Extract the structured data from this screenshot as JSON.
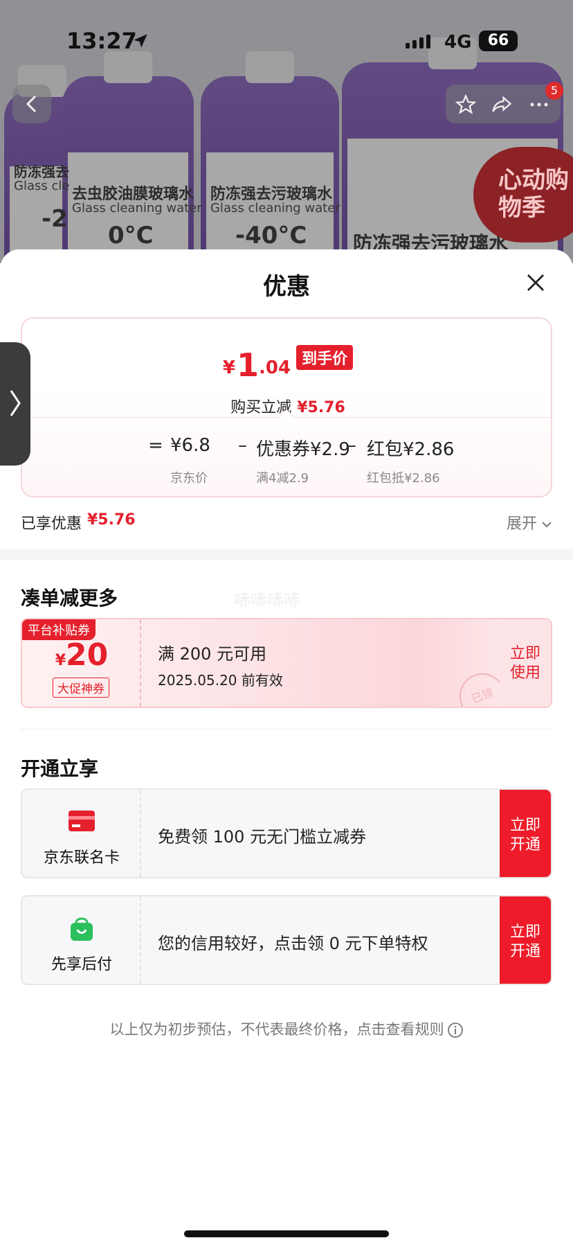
{
  "status": {
    "time": "13:27",
    "network": "4G",
    "battery": "66"
  },
  "product_bg": {
    "labels": [
      {
        "title": "防冻强去",
        "sub": "Glass cle",
        "temp": "-2"
      },
      {
        "title": "去虫胶油膜玻璃水",
        "sub": "Glass cleaning water",
        "temp": "0°C"
      },
      {
        "title": "防冻强去污玻璃水",
        "sub": "Glass cleaning water",
        "temp": "-40°C"
      },
      {
        "title": "防冻强去污玻璃水",
        "sub": "",
        "temp": ""
      }
    ],
    "promo_text": "心动购物季",
    "cart_badge": "5"
  },
  "sheet": {
    "title": "优惠",
    "price": {
      "yen": "¥",
      "integer": "1",
      "decimal": ".04",
      "tag": "到手价",
      "reduce_label": "购买立减",
      "reduce_value": "¥5.76"
    },
    "formula": {
      "eq": "=",
      "jd_price": "¥6.8",
      "jd_price_label": "京东价",
      "minus1": "–",
      "coupon": "优惠券¥2.9",
      "coupon_label": "满4减2.9",
      "minus2": "–",
      "redpack": "红包¥2.86",
      "redpack_label": "红包抵¥2.86"
    },
    "enjoyed_label": "已享优惠",
    "enjoyed_value": "¥5.76",
    "expand_label": "展开"
  },
  "combine": {
    "title": "凑单减更多",
    "watermark": "哧哧哧哧",
    "coupon": {
      "tag": "平台补贴券",
      "yen": "¥",
      "amount": "20",
      "type": "大促神券",
      "condition": "满 200 元可用",
      "valid": "2025.05.20 前有效",
      "button": "立即使用",
      "stamp": "已领"
    }
  },
  "open": {
    "title": "开通立享",
    "items": [
      {
        "name": "京东联名卡",
        "text": "免费领 100 元无门槛立减券",
        "button": "立即开通"
      },
      {
        "name": "先享后付",
        "text": "您的信用较好，点击领 0 元下单特权",
        "button": "立即开通"
      }
    ]
  },
  "disclaimer": "以上仅为初步预估，不代表最终价格，点击查看规则",
  "colors": {
    "accent": "#e4202c",
    "open_button": "#ee1c2a",
    "card_icon": "#e4202c",
    "pay_icon": "#2bbf5e"
  }
}
